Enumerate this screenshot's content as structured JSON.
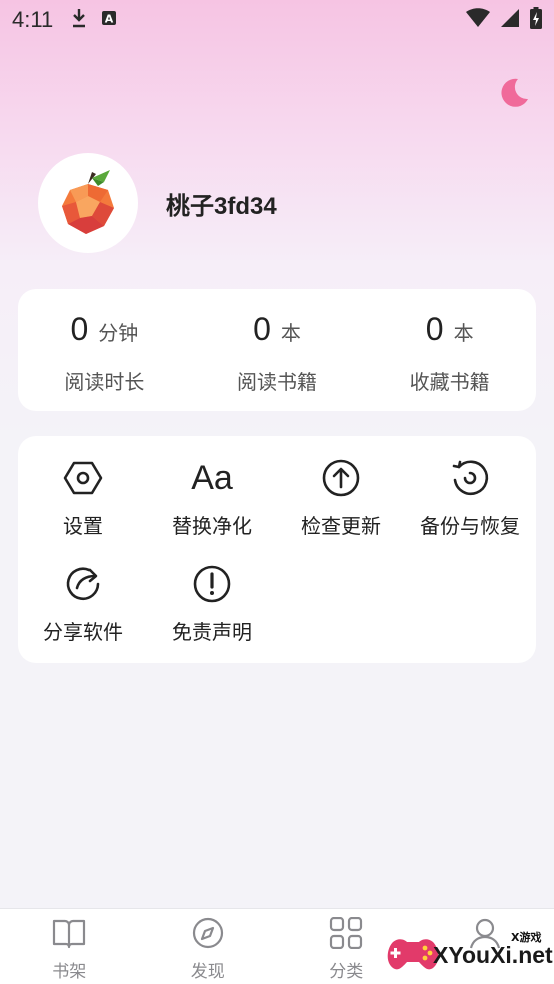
{
  "status_bar": {
    "time": "4:11",
    "icons": [
      "download-icon",
      "a-box-icon",
      "wifi-icon",
      "signal-icon",
      "battery-charging-icon"
    ]
  },
  "theme_toggle": {
    "icon": "moon-icon",
    "color": "#f06a9a"
  },
  "profile": {
    "username": "桃子3fd34",
    "avatar": "peach-icon"
  },
  "stats": [
    {
      "value": "0",
      "unit": "分钟",
      "label": "阅读时长"
    },
    {
      "value": "0",
      "unit": "本",
      "label": "阅读书籍"
    },
    {
      "value": "0",
      "unit": "本",
      "label": "收藏书籍"
    }
  ],
  "menu": [
    {
      "label": "设置",
      "icon": "hexagon-gear-icon"
    },
    {
      "label": "替换净化",
      "icon": "font-aa-icon",
      "glyph": "Aa"
    },
    {
      "label": "检查更新",
      "icon": "arrow-up-circle-icon"
    },
    {
      "label": "备份与恢复",
      "icon": "restore-icon"
    },
    {
      "label": "分享软件",
      "icon": "share-icon"
    },
    {
      "label": "免责声明",
      "icon": "exclamation-circle-icon"
    }
  ],
  "bottom_nav": [
    {
      "label": "书架",
      "icon": "book-open-icon"
    },
    {
      "label": "发现",
      "icon": "compass-icon"
    },
    {
      "label": "分类",
      "icon": "grid-icon"
    },
    {
      "label": "",
      "icon": "profile-icon"
    }
  ],
  "watermark": {
    "text": "XYouXi.net",
    "small": "X游戏"
  }
}
